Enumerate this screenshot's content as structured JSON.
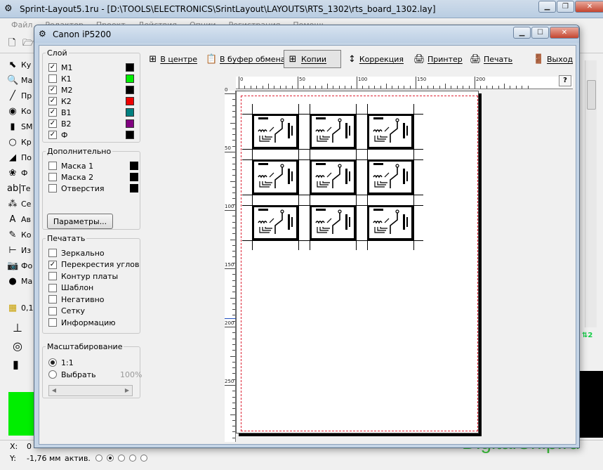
{
  "main_window": {
    "title": "Sprint-Layout5.1ru - [D:\\TOOLS\\ELECTRONICS\\SrintLayout\\LAYOUTS\\RTS_1302\\rts_board_1302.lay]",
    "menu": [
      "Файл",
      "Редактор",
      "Проект",
      "Действия",
      "Опции",
      "Регистрация",
      "Помощь"
    ],
    "tools": [
      {
        "icon": "cursor-icon",
        "glyph": "⬉",
        "label": "Ку"
      },
      {
        "icon": "zoom-icon",
        "glyph": "🔍",
        "label": "Ма"
      },
      {
        "icon": "track-icon",
        "glyph": "╱",
        "label": "Пр"
      },
      {
        "icon": "pad-icon",
        "glyph": "◉",
        "label": "Ко"
      },
      {
        "icon": "smd-icon",
        "glyph": "▮",
        "label": "SM"
      },
      {
        "icon": "circle-icon",
        "glyph": "○",
        "label": "Кр"
      },
      {
        "icon": "polygon-icon",
        "glyph": "◢",
        "label": "По"
      },
      {
        "icon": "shape-icon",
        "glyph": "❀",
        "label": "Ф"
      },
      {
        "icon": "text-icon",
        "glyph": "ab|",
        "label": "Те"
      },
      {
        "icon": "connection-icon",
        "glyph": "⁂",
        "label": "Се"
      },
      {
        "icon": "autoroute-icon",
        "glyph": "A",
        "label": "Ав"
      },
      {
        "icon": "check-icon",
        "glyph": "✎",
        "label": "Ко"
      },
      {
        "icon": "measure-icon",
        "glyph": "⊢",
        "label": "Из"
      },
      {
        "icon": "photo-icon",
        "glyph": "📷",
        "label": "Фо"
      },
      {
        "icon": "macro-icon",
        "glyph": "●",
        "label": "Ма"
      }
    ],
    "grid_value": "0,1",
    "status": {
      "x_label": "X:",
      "x_value": "0",
      "y_label": "Y:",
      "y_value": "-1,76 мм",
      "active_label": "актив."
    },
    "watermark": "DigitalChip.ru"
  },
  "dialog": {
    "title": "Canon iP5200",
    "toolbar": [
      {
        "name": "center-button",
        "icon": "center-icon",
        "glyph": "⊞",
        "label": "В центре",
        "active": false
      },
      {
        "name": "clipboard-button",
        "icon": "clipboard-icon",
        "glyph": "📋",
        "label": "В буфер обмена",
        "active": false
      },
      {
        "name": "copies-button",
        "icon": "copies-icon",
        "glyph": "⊞",
        "label": "Копии",
        "active": true
      },
      {
        "name": "correction-button",
        "icon": "correction-icon",
        "glyph": "↕",
        "label": "Коррекция",
        "active": false
      },
      {
        "name": "printer-button",
        "icon": "printer-setup-icon",
        "glyph": "🖨",
        "label": "Принтер",
        "active": false
      },
      {
        "name": "print-button",
        "icon": "print-icon",
        "glyph": "🖨",
        "label": "Печать",
        "active": false
      },
      {
        "name": "exit-button",
        "icon": "exit-icon",
        "glyph": "🚪",
        "label": "Выход",
        "active": false
      }
    ],
    "help": "?",
    "layers": {
      "title": "Слой",
      "items": [
        {
          "label": "М1",
          "checked": true,
          "color": "#000000"
        },
        {
          "label": "К1",
          "checked": false,
          "color": "#00ee00"
        },
        {
          "label": "М2",
          "checked": true,
          "color": "#000000"
        },
        {
          "label": "К2",
          "checked": true,
          "color": "#ee0000"
        },
        {
          "label": "В1",
          "checked": true,
          "color": "#008080"
        },
        {
          "label": "В2",
          "checked": true,
          "color": "#800080"
        },
        {
          "label": "Ф",
          "checked": true,
          "color": "#000000"
        }
      ]
    },
    "additional": {
      "title": "Дополнительно",
      "items": [
        {
          "label": "Маска 1",
          "checked": false
        },
        {
          "label": "Маска 2",
          "checked": false
        },
        {
          "label": "Отверстия",
          "checked": false
        }
      ],
      "params_button": "Параметры..."
    },
    "print_options": {
      "title": "Печатать",
      "items": [
        {
          "label": "Зеркально",
          "checked": false
        },
        {
          "label": "Перекрестия углов",
          "checked": true
        },
        {
          "label": "Контур платы",
          "checked": false
        },
        {
          "label": "Шаблон",
          "checked": false
        },
        {
          "label": "Негативно",
          "checked": false
        },
        {
          "label": "Сетку",
          "checked": false
        },
        {
          "label": "Информацию",
          "checked": false
        }
      ]
    },
    "scaling": {
      "title": "Масштабирование",
      "option_1to1": "1:1",
      "option_custom": "Выбрать",
      "selected": "1:1",
      "percent": "100%"
    },
    "ruler": {
      "h_labels": [
        "0",
        "50",
        "100",
        "150",
        "200"
      ],
      "v_labels": [
        "0",
        "50",
        "100",
        "150",
        "200",
        "250"
      ]
    },
    "preview": {
      "copies_rows": 3,
      "copies_cols": 3
    }
  }
}
